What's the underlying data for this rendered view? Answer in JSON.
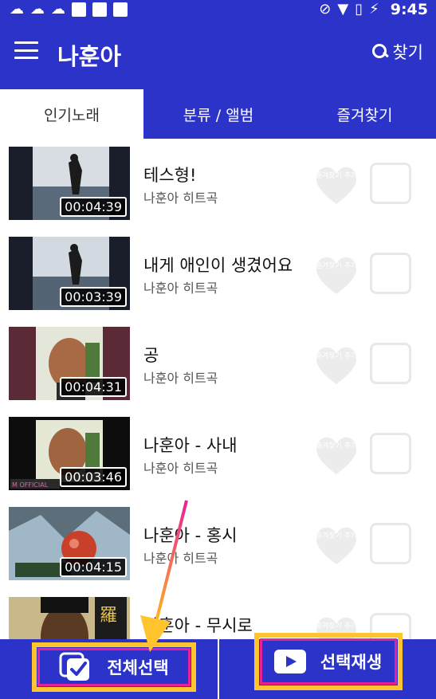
{
  "status_bar": {
    "time": "9:45",
    "icons": [
      "notification-icon",
      "notification-icon",
      "notification-icon",
      "square-icon",
      "square-icon",
      "square-icon",
      "dnd-icon",
      "wifi-icon",
      "no-sim-icon",
      "battery-charging-icon"
    ]
  },
  "app_bar": {
    "title": "나훈아",
    "search_label": "찾기"
  },
  "tabs": [
    {
      "label": "인기노래",
      "active": true
    },
    {
      "label": "분류 / 앨범",
      "active": false
    },
    {
      "label": "즐겨찾기",
      "active": false
    }
  ],
  "songs": [
    {
      "title": "테스형!",
      "subtitle": "나훈아 히트곡",
      "duration": "00:04:39",
      "fav_label": "즐겨찾기 추가"
    },
    {
      "title": "내게 애인이 생겼어요",
      "subtitle": "나훈아 히트곡",
      "duration": "00:03:39",
      "fav_label": "즐겨찾기 추가"
    },
    {
      "title": "공",
      "subtitle": "나훈아 히트곡",
      "duration": "00:04:31",
      "fav_label": "즐겨찾기 추가"
    },
    {
      "title": "나훈아 - 사내",
      "subtitle": "나훈아 히트곡",
      "duration": "00:03:46",
      "fav_label": "즐겨찾기 추가"
    },
    {
      "title": "나훈아 - 홍시",
      "subtitle": "나훈아 히트곡",
      "duration": "00:04:15",
      "fav_label": "즐겨찾기 추가"
    },
    {
      "title": "나훈아 - 무시로",
      "subtitle": "",
      "duration": "",
      "fav_label": "즐겨찾기 추가"
    }
  ],
  "bottom_bar": {
    "select_all_label": "전체선택",
    "play_selected_label": "선택재생"
  },
  "colors": {
    "primary": "#2b33c8",
    "highlight_outer": "#ffc42e",
    "highlight_inner": "#e8219a"
  }
}
